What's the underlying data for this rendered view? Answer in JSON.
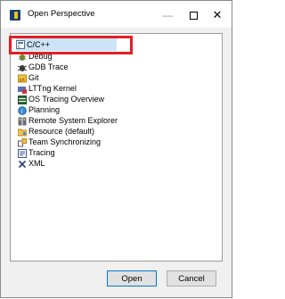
{
  "window": {
    "title": "Open Perspective"
  },
  "perspectives": [
    {
      "label": "C/C++",
      "icon": "cpp-perspective-icon",
      "selected": true
    },
    {
      "label": "Debug",
      "icon": "debug-bug-icon"
    },
    {
      "label": "GDB Trace",
      "icon": "gdb-trace-icon"
    },
    {
      "label": "Git",
      "icon": "git-repository-icon"
    },
    {
      "label": "LTTng Kernel",
      "icon": "lttng-kernel-icon"
    },
    {
      "label": "OS Tracing Overview",
      "icon": "os-tracing-icon"
    },
    {
      "label": "Planning",
      "icon": "planning-icon"
    },
    {
      "label": "Remote System Explorer",
      "icon": "remote-system-icon"
    },
    {
      "label": "Resource (default)",
      "icon": "resource-folder-icon"
    },
    {
      "label": "Team Synchronizing",
      "icon": "team-sync-icon"
    },
    {
      "label": "Tracing",
      "icon": "tracing-icon"
    },
    {
      "label": "XML",
      "icon": "xml-icon"
    }
  ],
  "buttons": {
    "open": "Open",
    "cancel": "Cancel"
  },
  "colors": {
    "selection": "#cce4f7",
    "annotation_box": "#e11f25",
    "default_button_border": "#0078d7"
  }
}
